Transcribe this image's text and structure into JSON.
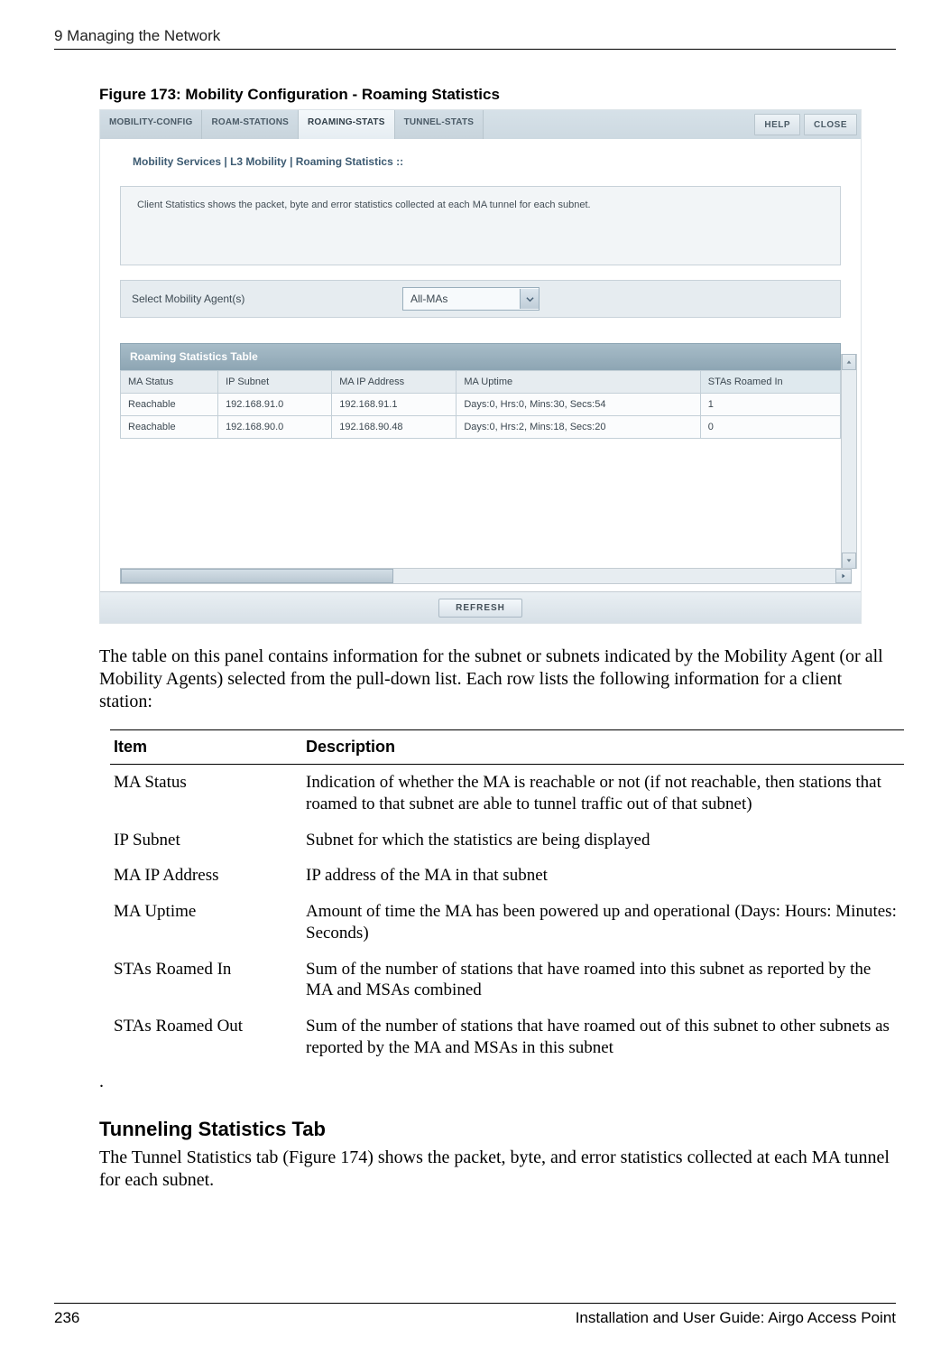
{
  "running_head": "9  Managing the Network",
  "figure_caption": "Figure 173:    Mobility Configuration - Roaming Statistics",
  "screenshot": {
    "tabs": [
      "MOBILITY-CONFIG",
      "ROAM-STATIONS",
      "ROAMING-STATS",
      "TUNNEL-STATS"
    ],
    "active_tab_index": 2,
    "help_label": "HELP",
    "close_label": "CLOSE",
    "breadcrumb": "Mobility Services | L3 Mobility | Roaming Statistics  ::",
    "info_text": "Client Statistics shows the packet, byte and error statistics collected at each MA tunnel for each subnet.",
    "select_label": "Select Mobility Agent(s)",
    "select_value": "All-MAs",
    "section_title": "Roaming Statistics Table",
    "columns": [
      "MA Status",
      "IP Subnet",
      "MA IP Address",
      "MA Uptime",
      "STAs Roamed In"
    ],
    "rows": [
      {
        "status": "Reachable",
        "subnet": "192.168.91.0",
        "ip": "192.168.91.1",
        "uptime": "Days:0, Hrs:0, Mins:30, Secs:54",
        "roamed": "1"
      },
      {
        "status": "Reachable",
        "subnet": "192.168.90.0",
        "ip": "192.168.90.48",
        "uptime": "Days:0, Hrs:2, Mins:18, Secs:20",
        "roamed": "0"
      }
    ],
    "refresh_label": "REFRESH"
  },
  "intro_para": "The table on this panel contains information for the subnet or subnets indicated by the Mobility Agent (or all Mobility Agents) selected from the pull-down list. Each row lists the following information for a client station:",
  "desc_headers": {
    "item": "Item",
    "desc": "Description"
  },
  "desc_rows": [
    {
      "item": "MA Status",
      "desc": "Indication of whether the MA is reachable or not (if not reachable, then stations that roamed to that subnet are able to tunnel traffic out of that subnet)"
    },
    {
      "item": "IP Subnet",
      "desc": "Subnet for which the statistics are being displayed"
    },
    {
      "item": "MA IP Address",
      "desc": "IP address of the MA in that subnet"
    },
    {
      "item": "MA Uptime",
      "desc": "Amount of time the MA has been powered up and operational (Days: Hours: Minutes: Seconds)"
    },
    {
      "item": "STAs Roamed In",
      "desc": "Sum of the number of stations that have roamed into this subnet as reported by the MA and MSAs combined"
    },
    {
      "item": "STAs Roamed Out",
      "desc": "Sum of the number of stations that have roamed out of this subnet to other subnets as reported by the MA and MSAs in this subnet"
    }
  ],
  "heading2": "Tunneling Statistics Tab",
  "para2": "The Tunnel Statistics tab (Figure 174) shows the packet, byte, and error statistics collected at each MA tunnel for each subnet.",
  "footer": {
    "page": "236",
    "title": "Installation and User Guide: Airgo Access Point"
  }
}
